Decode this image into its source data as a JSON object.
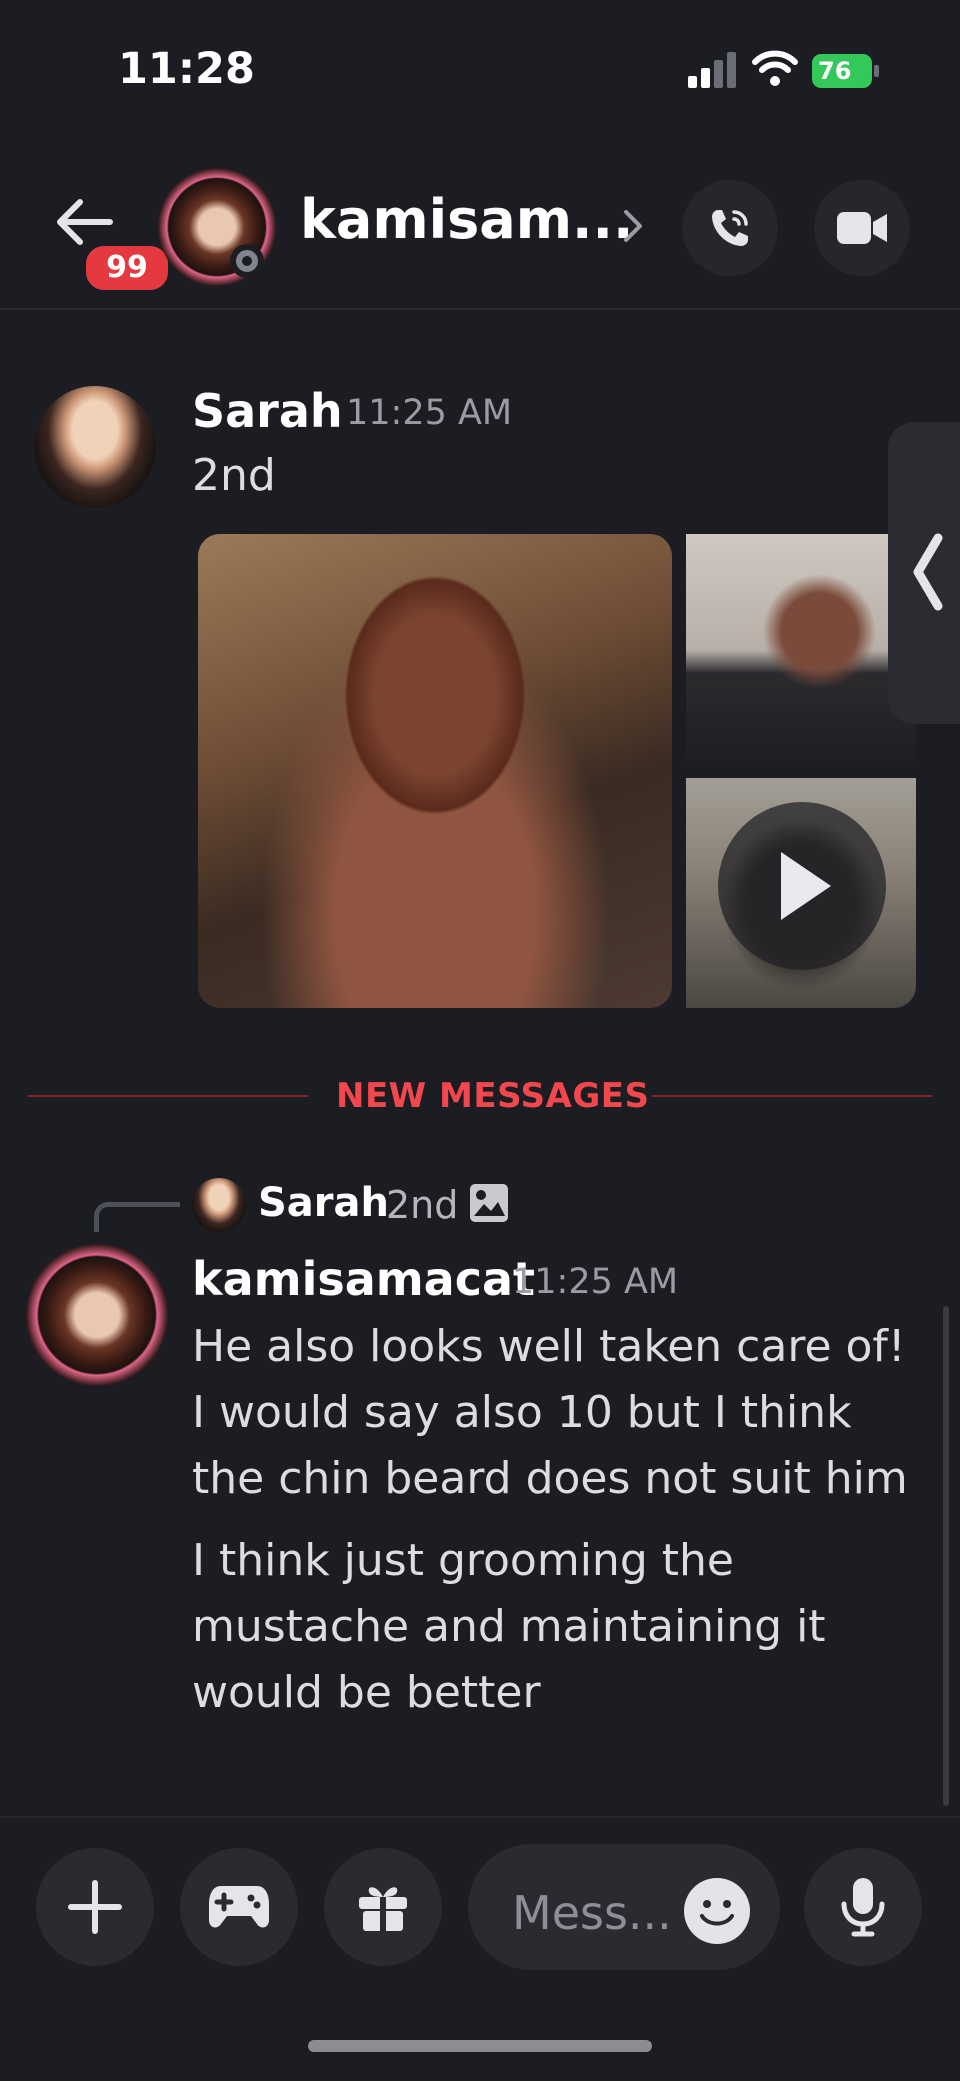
{
  "status_bar": {
    "time": "11:28",
    "battery": "76"
  },
  "header": {
    "unread_badge": "99",
    "channel_name": "kamisam...",
    "icons": [
      "back-arrow-icon",
      "chevron-right-icon",
      "phone-call-icon",
      "video-camera-icon"
    ]
  },
  "messages": [
    {
      "author": "Sarah",
      "time": "11:25 AM",
      "text": "2nd",
      "attachments": [
        "photo",
        "photo",
        "video"
      ]
    },
    {
      "reply_to": {
        "author": "Sarah",
        "text": "2nd"
      },
      "author": "kamisamacat",
      "time": "11:25 AM",
      "paragraphs": [
        "He also looks well taken care of! I would say also 10 but I think the chin beard does not suit him",
        "I think just grooming the mustache and maintaining it would be better"
      ]
    }
  ],
  "divider": {
    "label": "NEW MESSAGES"
  },
  "composer": {
    "placeholder": "Mess...",
    "buttons": [
      "plus-icon",
      "gamepad-icon",
      "gift-icon",
      "emoji-icon",
      "microphone-icon"
    ]
  },
  "colors": {
    "background": "#1c1d22",
    "new_messages_red": "#f2474d",
    "badge_red": "#e5393f",
    "battery_green": "#34c759"
  }
}
